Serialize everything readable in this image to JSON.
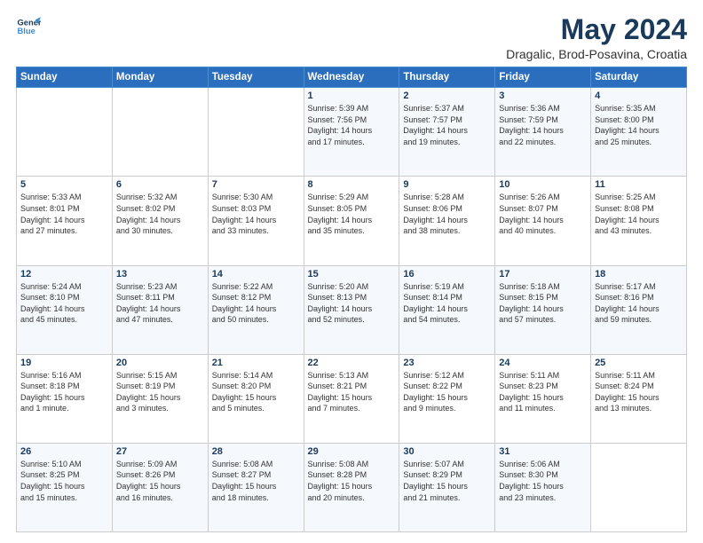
{
  "logo": {
    "line1": "General",
    "line2": "Blue"
  },
  "title": "May 2024",
  "subtitle": "Dragalic, Brod-Posavina, Croatia",
  "weekdays": [
    "Sunday",
    "Monday",
    "Tuesday",
    "Wednesday",
    "Thursday",
    "Friday",
    "Saturday"
  ],
  "weeks": [
    [
      {
        "day": "",
        "info": ""
      },
      {
        "day": "",
        "info": ""
      },
      {
        "day": "",
        "info": ""
      },
      {
        "day": "1",
        "info": "Sunrise: 5:39 AM\nSunset: 7:56 PM\nDaylight: 14 hours\nand 17 minutes."
      },
      {
        "day": "2",
        "info": "Sunrise: 5:37 AM\nSunset: 7:57 PM\nDaylight: 14 hours\nand 19 minutes."
      },
      {
        "day": "3",
        "info": "Sunrise: 5:36 AM\nSunset: 7:59 PM\nDaylight: 14 hours\nand 22 minutes."
      },
      {
        "day": "4",
        "info": "Sunrise: 5:35 AM\nSunset: 8:00 PM\nDaylight: 14 hours\nand 25 minutes."
      }
    ],
    [
      {
        "day": "5",
        "info": "Sunrise: 5:33 AM\nSunset: 8:01 PM\nDaylight: 14 hours\nand 27 minutes."
      },
      {
        "day": "6",
        "info": "Sunrise: 5:32 AM\nSunset: 8:02 PM\nDaylight: 14 hours\nand 30 minutes."
      },
      {
        "day": "7",
        "info": "Sunrise: 5:30 AM\nSunset: 8:03 PM\nDaylight: 14 hours\nand 33 minutes."
      },
      {
        "day": "8",
        "info": "Sunrise: 5:29 AM\nSunset: 8:05 PM\nDaylight: 14 hours\nand 35 minutes."
      },
      {
        "day": "9",
        "info": "Sunrise: 5:28 AM\nSunset: 8:06 PM\nDaylight: 14 hours\nand 38 minutes."
      },
      {
        "day": "10",
        "info": "Sunrise: 5:26 AM\nSunset: 8:07 PM\nDaylight: 14 hours\nand 40 minutes."
      },
      {
        "day": "11",
        "info": "Sunrise: 5:25 AM\nSunset: 8:08 PM\nDaylight: 14 hours\nand 43 minutes."
      }
    ],
    [
      {
        "day": "12",
        "info": "Sunrise: 5:24 AM\nSunset: 8:10 PM\nDaylight: 14 hours\nand 45 minutes."
      },
      {
        "day": "13",
        "info": "Sunrise: 5:23 AM\nSunset: 8:11 PM\nDaylight: 14 hours\nand 47 minutes."
      },
      {
        "day": "14",
        "info": "Sunrise: 5:22 AM\nSunset: 8:12 PM\nDaylight: 14 hours\nand 50 minutes."
      },
      {
        "day": "15",
        "info": "Sunrise: 5:20 AM\nSunset: 8:13 PM\nDaylight: 14 hours\nand 52 minutes."
      },
      {
        "day": "16",
        "info": "Sunrise: 5:19 AM\nSunset: 8:14 PM\nDaylight: 14 hours\nand 54 minutes."
      },
      {
        "day": "17",
        "info": "Sunrise: 5:18 AM\nSunset: 8:15 PM\nDaylight: 14 hours\nand 57 minutes."
      },
      {
        "day": "18",
        "info": "Sunrise: 5:17 AM\nSunset: 8:16 PM\nDaylight: 14 hours\nand 59 minutes."
      }
    ],
    [
      {
        "day": "19",
        "info": "Sunrise: 5:16 AM\nSunset: 8:18 PM\nDaylight: 15 hours\nand 1 minute."
      },
      {
        "day": "20",
        "info": "Sunrise: 5:15 AM\nSunset: 8:19 PM\nDaylight: 15 hours\nand 3 minutes."
      },
      {
        "day": "21",
        "info": "Sunrise: 5:14 AM\nSunset: 8:20 PM\nDaylight: 15 hours\nand 5 minutes."
      },
      {
        "day": "22",
        "info": "Sunrise: 5:13 AM\nSunset: 8:21 PM\nDaylight: 15 hours\nand 7 minutes."
      },
      {
        "day": "23",
        "info": "Sunrise: 5:12 AM\nSunset: 8:22 PM\nDaylight: 15 hours\nand 9 minutes."
      },
      {
        "day": "24",
        "info": "Sunrise: 5:11 AM\nSunset: 8:23 PM\nDaylight: 15 hours\nand 11 minutes."
      },
      {
        "day": "25",
        "info": "Sunrise: 5:11 AM\nSunset: 8:24 PM\nDaylight: 15 hours\nand 13 minutes."
      }
    ],
    [
      {
        "day": "26",
        "info": "Sunrise: 5:10 AM\nSunset: 8:25 PM\nDaylight: 15 hours\nand 15 minutes."
      },
      {
        "day": "27",
        "info": "Sunrise: 5:09 AM\nSunset: 8:26 PM\nDaylight: 15 hours\nand 16 minutes."
      },
      {
        "day": "28",
        "info": "Sunrise: 5:08 AM\nSunset: 8:27 PM\nDaylight: 15 hours\nand 18 minutes."
      },
      {
        "day": "29",
        "info": "Sunrise: 5:08 AM\nSunset: 8:28 PM\nDaylight: 15 hours\nand 20 minutes."
      },
      {
        "day": "30",
        "info": "Sunrise: 5:07 AM\nSunset: 8:29 PM\nDaylight: 15 hours\nand 21 minutes."
      },
      {
        "day": "31",
        "info": "Sunrise: 5:06 AM\nSunset: 8:30 PM\nDaylight: 15 hours\nand 23 minutes."
      },
      {
        "day": "",
        "info": ""
      }
    ]
  ]
}
